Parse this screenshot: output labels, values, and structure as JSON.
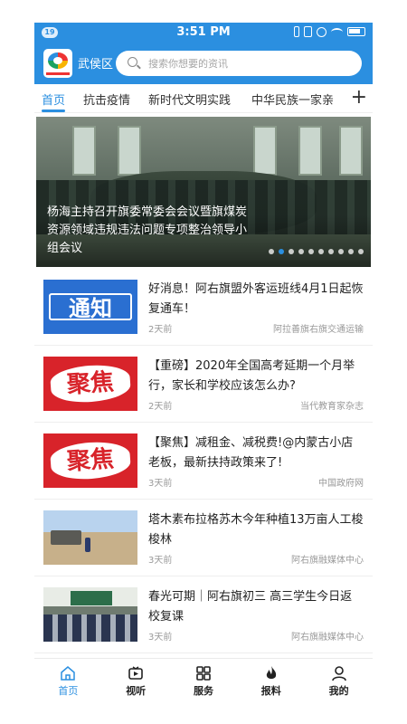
{
  "status_bar": {
    "badge": "19",
    "time": "3:51 PM"
  },
  "header": {
    "district": "武侯区",
    "search_placeholder": "搜索你想要的资讯"
  },
  "tabs": [
    {
      "label": "首页",
      "active": true
    },
    {
      "label": "抗击疫情"
    },
    {
      "label": "新时代文明实践"
    },
    {
      "label": "中华民族一家亲"
    }
  ],
  "tab_more": "+",
  "banner": {
    "caption": "杨海主持召开旗委常委会会议暨旗煤炭资源领域违规违法问题专项整治领导小组会议",
    "dot_count": 10,
    "active_dot": 1
  },
  "news": [
    {
      "thumb_text": "通知",
      "title": "好消息！阿右旗盟外客运班线4月1日起恢复通车！",
      "time": "2天前",
      "source": "阿拉善旗右旗交通运输"
    },
    {
      "thumb_text": "聚焦",
      "title": "【重磅】2020年全国高考延期一个月举行，家长和学校应该怎么办?",
      "time": "2天前",
      "source": "当代教育家杂志"
    },
    {
      "thumb_text": "聚焦",
      "title": "【聚焦】减租金、减税费!@内蒙古小店老板，最新扶持政策来了!",
      "time": "3天前",
      "source": "中国政府网"
    },
    {
      "thumb_text": "",
      "title": "塔木素布拉格苏木今年种植13万亩人工梭梭林",
      "time": "3天前",
      "source": "阿右旗融媒体中心"
    },
    {
      "thumb_text": "",
      "title": "春光可期｜阿右旗初三 高三学生今日返校复课",
      "time": "3天前",
      "source": "阿右旗融媒体中心"
    }
  ],
  "bottom_nav": [
    {
      "label": "首页",
      "icon": "home-icon",
      "active": true
    },
    {
      "label": "视听",
      "icon": "tv-play-icon"
    },
    {
      "label": "服务",
      "icon": "grid-icon"
    },
    {
      "label": "报料",
      "icon": "flame-icon"
    },
    {
      "label": "我的",
      "icon": "user-icon"
    }
  ],
  "colors": {
    "accent": "#2b8fe0",
    "red": "#d8232a"
  }
}
